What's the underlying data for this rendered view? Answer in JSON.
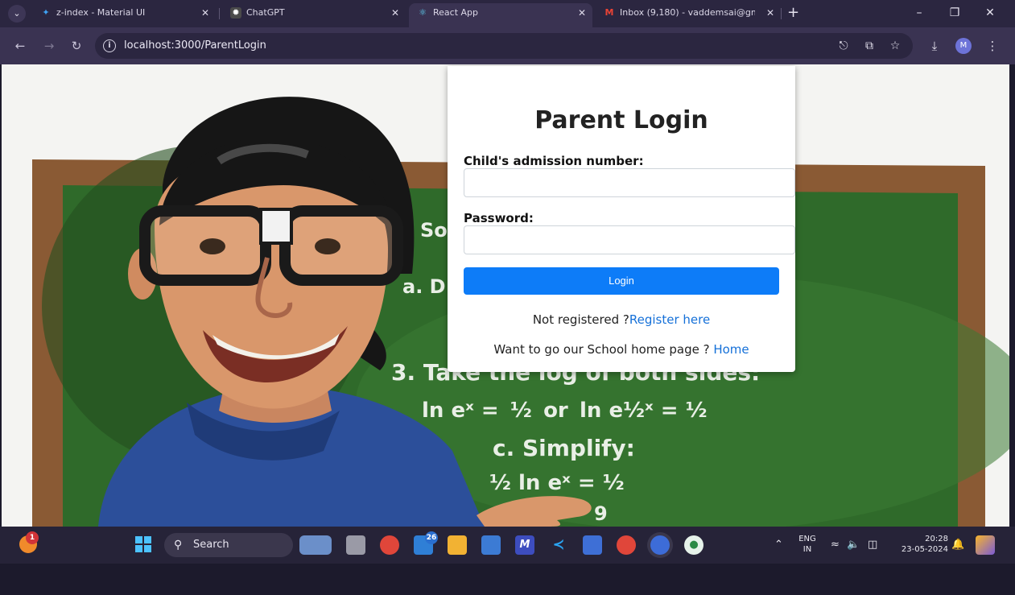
{
  "browser": {
    "tabs": [
      {
        "title": "z-index - Material UI",
        "icon": "material-ui-icon"
      },
      {
        "title": "ChatGPT",
        "icon": "chatgpt-icon"
      },
      {
        "title": "React App",
        "icon": "react-icon",
        "active": true
      },
      {
        "title": "Inbox (9,180) - vaddemsai@gm",
        "icon": "gmail-icon"
      }
    ],
    "url": "localhost:3000/ParentLogin",
    "profile_initial": "M"
  },
  "login": {
    "title": "Parent Login",
    "admission_label": "Child's admission number:",
    "password_label": "Password:",
    "button_label": "Login",
    "register_prompt": "Not registered ?",
    "register_link": "Register here",
    "home_prompt": "Want to go our School home page ? ",
    "home_link": "Home"
  },
  "background": {
    "board_text": [
      {
        "text": "So"
      },
      {
        "text": "a. D"
      },
      {
        "text": "3. Take the log of both sides:"
      },
      {
        "text": "ln eˣ =  ½  or  ln e½ˣ = ½"
      },
      {
        "text": "c. Simplify:"
      },
      {
        "text": "½ ln eˣ = ½"
      },
      {
        "text": "9"
      }
    ],
    "colors": {
      "chalkboard": "#2f6a2a",
      "frame": "#8a5a34",
      "shirt": "#2c4f9a",
      "skin": "#d9976b",
      "hair": "#161616"
    }
  },
  "taskbar": {
    "search_label": "Search",
    "notification_count": "1",
    "mail_badge": "26",
    "language": "ENG",
    "region": "IN",
    "time": "20:28",
    "date": "23-05-2024"
  }
}
